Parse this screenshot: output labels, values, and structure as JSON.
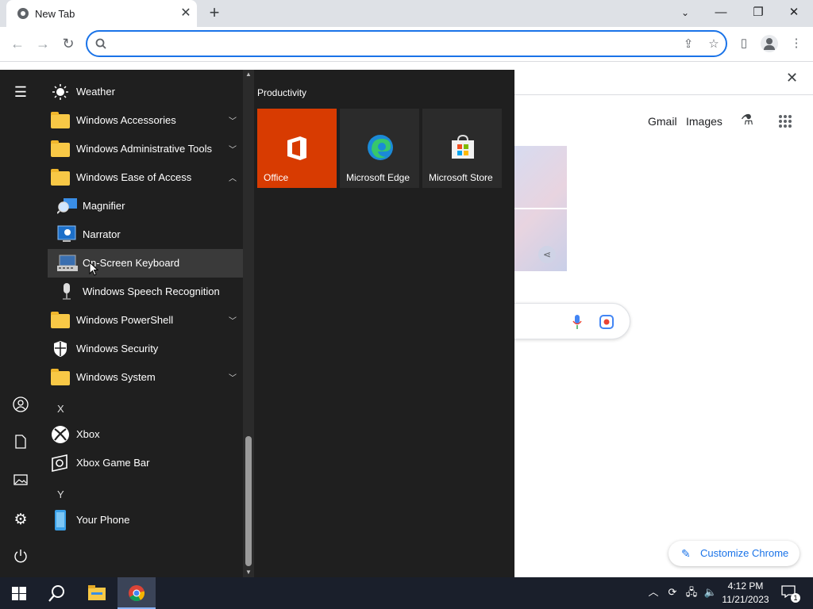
{
  "browser": {
    "tab_title": "New Tab",
    "newtab_symbol": "+",
    "omnibox_value": "",
    "window_controls": [
      "minimize",
      "restore",
      "close"
    ]
  },
  "ntp": {
    "links": [
      "Gmail",
      "Images"
    ],
    "customize_label": "Customize Chrome"
  },
  "start_menu": {
    "apps": [
      {
        "label": "Weather",
        "icon": "weather-sun-icon"
      },
      {
        "label": "Windows Accessories",
        "icon": "folder-icon",
        "chevron": "down"
      },
      {
        "label": "Windows Administrative Tools",
        "icon": "folder-icon",
        "chevron": "down"
      },
      {
        "label": "Windows Ease of Access",
        "icon": "folder-icon",
        "chevron": "up"
      },
      {
        "label": "Magnifier",
        "icon": "magnifier-icon"
      },
      {
        "label": "Narrator",
        "icon": "narrator-icon"
      },
      {
        "label": "On-Screen Keyboard",
        "icon": "keyboard-icon"
      },
      {
        "label": "Windows Speech Recognition",
        "icon": "microphone-icon"
      },
      {
        "label": "Windows PowerShell",
        "icon": "folder-icon",
        "chevron": "down"
      },
      {
        "label": "Windows Security",
        "icon": "shield-icon"
      },
      {
        "label": "Windows System",
        "icon": "folder-icon",
        "chevron": "down"
      },
      {
        "label": "Xbox",
        "icon": "xbox-icon"
      },
      {
        "label": "Xbox Game Bar",
        "icon": "xbox-game-bar-icon"
      },
      {
        "label": "Your Phone",
        "icon": "phone-icon"
      }
    ],
    "letters": [
      "X",
      "Y"
    ],
    "tile_group": "Productivity",
    "tiles": [
      {
        "label": "Office",
        "color": "#d83b01"
      },
      {
        "label": "Microsoft Edge",
        "color": "#2b2b2b"
      },
      {
        "label": "Microsoft Store",
        "color": "#2b2b2b"
      }
    ]
  },
  "taskbar": {
    "time": "4:12 PM",
    "date": "11/21/2023",
    "notification_count": "1"
  }
}
